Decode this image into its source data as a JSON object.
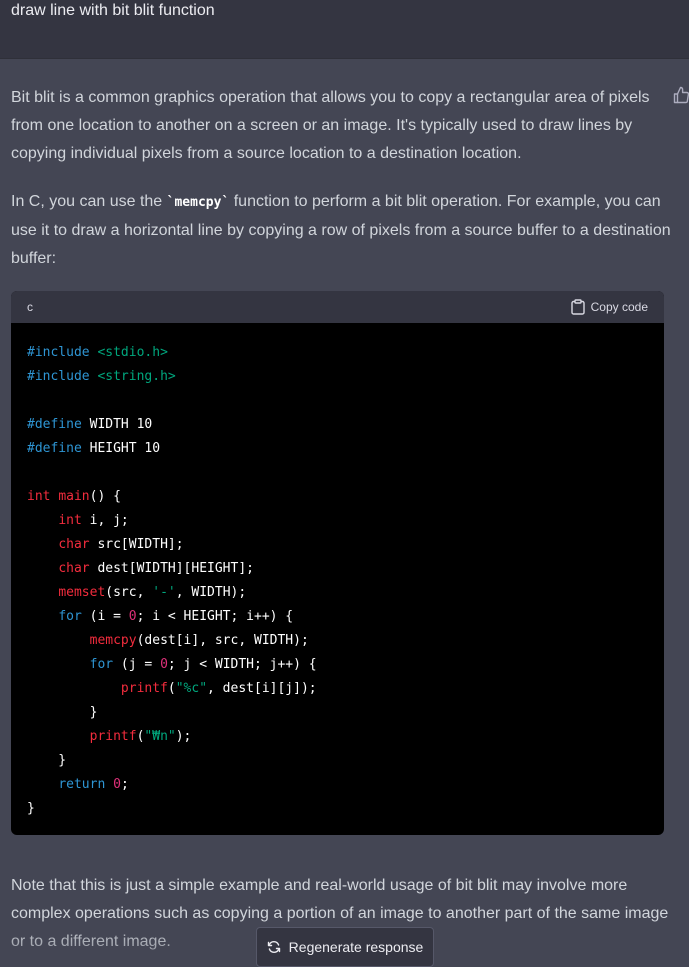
{
  "user_message": "draw line with bit blit function",
  "assistant": {
    "paragraph1": "Bit blit is a common graphics operation that allows you to copy a rectangular area of pixels from one location to another on a screen or an image. It's typically used to draw lines by copying individual pixels from a source location to a destination location.",
    "paragraph2_before": "In C, you can use the ",
    "paragraph2_code": "`memcpy`",
    "paragraph2_after": " function to perform a bit blit operation. For example, you can use it to draw a horizontal line by copying a row of pixels from a source buffer to a destination buffer:",
    "paragraph3": "Note that this is just a simple example and real-world usage of bit blit may involve more complex operations such as copying a portion of an image to another part of the same image or to a different image."
  },
  "code_block": {
    "language": "c",
    "copy_label": "Copy code",
    "lines": [
      [
        {
          "t": "#include ",
          "c": "kw"
        },
        {
          "t": "<stdio.h>",
          "c": "str"
        }
      ],
      [
        {
          "t": "#include ",
          "c": "kw"
        },
        {
          "t": "<string.h>",
          "c": "str"
        }
      ],
      [],
      [
        {
          "t": "#define ",
          "c": "kw"
        },
        {
          "t": "WIDTH 10",
          "c": ""
        }
      ],
      [
        {
          "t": "#define ",
          "c": "kw"
        },
        {
          "t": "HEIGHT 10",
          "c": ""
        }
      ],
      [],
      [
        {
          "t": "int ",
          "c": "ty"
        },
        {
          "t": "main",
          "c": "ty"
        },
        {
          "t": "() {",
          "c": ""
        }
      ],
      [
        {
          "t": "    ",
          "c": ""
        },
        {
          "t": "int",
          "c": "ty"
        },
        {
          "t": " i, j;",
          "c": ""
        }
      ],
      [
        {
          "t": "    ",
          "c": ""
        },
        {
          "t": "char",
          "c": "ty"
        },
        {
          "t": " src[WIDTH];",
          "c": ""
        }
      ],
      [
        {
          "t": "    ",
          "c": ""
        },
        {
          "t": "char",
          "c": "ty"
        },
        {
          "t": " dest[WIDTH][HEIGHT];",
          "c": ""
        }
      ],
      [
        {
          "t": "    ",
          "c": ""
        },
        {
          "t": "memset",
          "c": "ty"
        },
        {
          "t": "(src, ",
          "c": ""
        },
        {
          "t": "'-'",
          "c": "str"
        },
        {
          "t": ", WIDTH);",
          "c": ""
        }
      ],
      [
        {
          "t": "    ",
          "c": ""
        },
        {
          "t": "for",
          "c": "kw"
        },
        {
          "t": " (i = ",
          "c": ""
        },
        {
          "t": "0",
          "c": "num"
        },
        {
          "t": "; i < HEIGHT; i++) {",
          "c": ""
        }
      ],
      [
        {
          "t": "        ",
          "c": ""
        },
        {
          "t": "memcpy",
          "c": "ty"
        },
        {
          "t": "(dest[i], src, WIDTH);",
          "c": ""
        }
      ],
      [
        {
          "t": "        ",
          "c": ""
        },
        {
          "t": "for",
          "c": "kw"
        },
        {
          "t": " (j = ",
          "c": ""
        },
        {
          "t": "0",
          "c": "num"
        },
        {
          "t": "; j < WIDTH; j++) {",
          "c": ""
        }
      ],
      [
        {
          "t": "            ",
          "c": ""
        },
        {
          "t": "printf",
          "c": "ty"
        },
        {
          "t": "(",
          "c": ""
        },
        {
          "t": "\"%c\"",
          "c": "str"
        },
        {
          "t": ", dest[i][j]);",
          "c": ""
        }
      ],
      [
        {
          "t": "        }",
          "c": ""
        }
      ],
      [
        {
          "t": "        ",
          "c": ""
        },
        {
          "t": "printf",
          "c": "ty"
        },
        {
          "t": "(",
          "c": ""
        },
        {
          "t": "\"₩n\"",
          "c": "str"
        },
        {
          "t": ");",
          "c": ""
        }
      ],
      [
        {
          "t": "    }",
          "c": ""
        }
      ],
      [
        {
          "t": "    ",
          "c": ""
        },
        {
          "t": "return",
          "c": "kw"
        },
        {
          "t": " ",
          "c": ""
        },
        {
          "t": "0",
          "c": "num"
        },
        {
          "t": ";",
          "c": ""
        }
      ],
      [
        {
          "t": "}",
          "c": ""
        }
      ]
    ]
  },
  "regenerate_label": "Regenerate response",
  "colors": {
    "background": "#444654",
    "user_bar": "#343541",
    "code_bg": "#000000",
    "keyword": "#2e95d3",
    "type": "#f22c3d",
    "string": "#00a67d",
    "number": "#df3079"
  }
}
